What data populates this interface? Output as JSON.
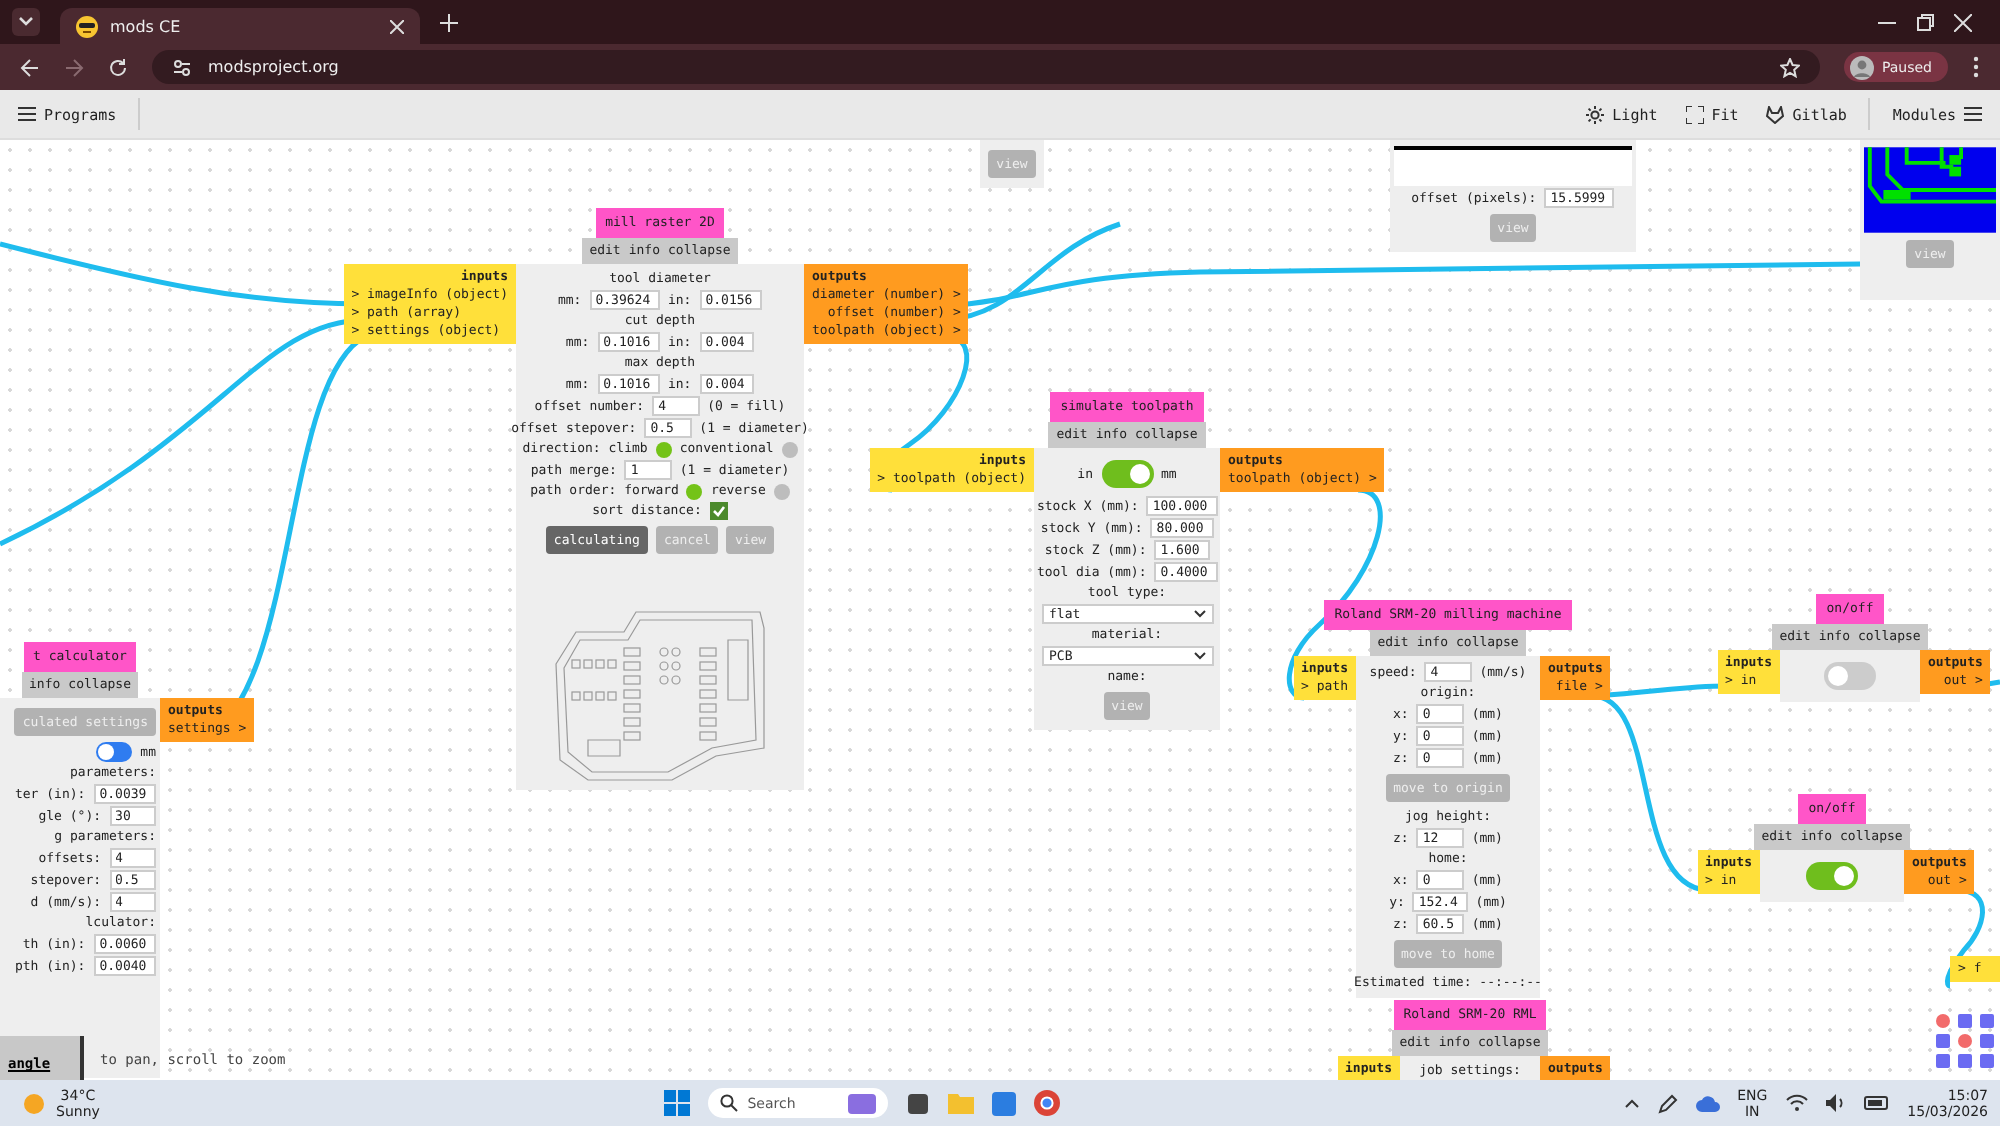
{
  "browser": {
    "tab_title": "mods CE",
    "url": "modsproject.org",
    "profile_label": "Paused"
  },
  "toolbar": {
    "programs": "Programs",
    "light": "Light",
    "fit": "Fit",
    "gitlab": "Gitlab",
    "modules": "Modules"
  },
  "modules": [
    {
      "rows": [
        [
          {
            "kind": "button",
            "label": "view",
            "disabled": true
          }
        ]
      ]
    },
    {
      "title": "mill raster 2D",
      "actions": [
        "edit",
        "info",
        "collapse"
      ],
      "inputs": {
        "label": "inputs",
        "ports": [
          "> imageInfo (object)",
          "> path (array)",
          "> settings (object)"
        ]
      },
      "outputs": {
        "label": "outputs",
        "ports": [
          "diameter (number) >",
          "offset (number) >",
          "toolpath (object) >"
        ]
      },
      "rows": [
        [
          {
            "kind": "text",
            "text": "tool diameter"
          }
        ],
        [
          {
            "kind": "text",
            "text": "mm:"
          },
          {
            "kind": "input",
            "value": "0.39624"
          },
          {
            "kind": "text",
            "text": "in:"
          },
          {
            "kind": "input",
            "value": "0.0156"
          }
        ],
        [
          {
            "kind": "text",
            "text": "cut depth"
          }
        ],
        [
          {
            "kind": "text",
            "text": "mm:"
          },
          {
            "kind": "input",
            "value": "0.1016"
          },
          {
            "kind": "text",
            "text": "in:"
          },
          {
            "kind": "input",
            "value": "0.004"
          }
        ],
        [
          {
            "kind": "text",
            "text": "max depth"
          }
        ],
        [
          {
            "kind": "text",
            "text": "mm:"
          },
          {
            "kind": "input",
            "value": "0.1016"
          },
          {
            "kind": "text",
            "text": "in:"
          },
          {
            "kind": "input",
            "value": "0.004"
          }
        ],
        [
          {
            "kind": "text",
            "text": "offset number:"
          },
          {
            "kind": "input",
            "value": "4"
          },
          {
            "kind": "text",
            "text": "(0 = fill)"
          }
        ],
        [
          {
            "kind": "text",
            "text": "offset stepover:"
          },
          {
            "kind": "input",
            "value": "0.5"
          },
          {
            "kind": "text",
            "text": "(1 = diameter)"
          }
        ],
        [
          {
            "kind": "text",
            "text": "direction: climb"
          },
          {
            "kind": "radio",
            "selected": true
          },
          {
            "kind": "text",
            "text": "conventional"
          },
          {
            "kind": "radio",
            "selected": false
          }
        ],
        [
          {
            "kind": "text",
            "text": "path merge:"
          },
          {
            "kind": "input",
            "value": "1"
          },
          {
            "kind": "text",
            "text": "(1 = diameter)"
          }
        ],
        [
          {
            "kind": "text",
            "text": "path order: forward"
          },
          {
            "kind": "radio",
            "selected": true
          },
          {
            "kind": "text",
            "text": "reverse"
          },
          {
            "kind": "radio",
            "selected": false
          }
        ],
        [
          {
            "kind": "text",
            "text": "sort distance:"
          },
          {
            "kind": "checkbox",
            "checked": true
          }
        ],
        [
          {
            "kind": "button",
            "label": "calculating",
            "disabled": false
          },
          {
            "kind": "button",
            "label": "cancel",
            "disabled": true
          },
          {
            "kind": "button",
            "label": "view",
            "disabled": true
          }
        ],
        [
          {
            "kind": "preview"
          }
        ]
      ]
    },
    {
      "rows": [
        [
          {
            "kind": "strip"
          }
        ],
        [
          {
            "kind": "text",
            "text": "offset (pixels):"
          },
          {
            "kind": "input",
            "value": "15.5999"
          }
        ],
        [
          {
            "kind": "button",
            "label": "view",
            "disabled": true
          }
        ]
      ]
    },
    {
      "rows": [
        [
          {
            "kind": "pcb"
          }
        ],
        [
          {
            "kind": "button",
            "label": "view",
            "disabled": true
          }
        ]
      ]
    },
    {
      "title": "t calculator",
      "actions": [
        "info",
        "collapse"
      ],
      "outputs": {
        "label": "outputs",
        "ports": [
          "settings >"
        ]
      },
      "rows": [
        [
          {
            "kind": "button",
            "label": "culated settings",
            "disabled": true
          }
        ],
        [
          {
            "kind": "switch",
            "on": false
          },
          {
            "kind": "text",
            "text": "mm"
          }
        ],
        [
          {
            "kind": "text",
            "text": "parameters:"
          }
        ],
        [
          {
            "kind": "text",
            "text": "ter (in):"
          },
          {
            "kind": "input",
            "value": "0.0039"
          }
        ],
        [
          {
            "kind": "text",
            "text": "gle (°):"
          },
          {
            "kind": "input",
            "value": "30"
          }
        ],
        [
          {
            "kind": "text",
            "text": "g parameters:"
          }
        ],
        [
          {
            "kind": "text",
            "text": "offsets:"
          },
          {
            "kind": "input",
            "value": "4"
          }
        ],
        [
          {
            "kind": "text",
            "text": "stepover:"
          },
          {
            "kind": "input",
            "value": "0.5"
          }
        ],
        [
          {
            "kind": "text",
            "text": "d (mm/s):"
          },
          {
            "kind": "input",
            "value": "4"
          }
        ],
        [
          {
            "kind": "text",
            "text": "lculator:"
          }
        ],
        [
          {
            "kind": "text",
            "text": "th (in):"
          },
          {
            "kind": "input",
            "value": "0.0060"
          }
        ],
        [
          {
            "kind": "text",
            "text": "pth (in):"
          },
          {
            "kind": "input",
            "value": "0.0040"
          }
        ]
      ]
    },
    {
      "title": "simulate toolpath",
      "actions": [
        "edit",
        "info",
        "collapse"
      ],
      "inputs": {
        "label": "inputs",
        "ports": [
          "> toolpath (object)"
        ]
      },
      "outputs": {
        "label": "outputs",
        "ports": [
          "toolpath (object) >"
        ]
      },
      "rows": [
        [
          {
            "kind": "text",
            "text": "in"
          },
          {
            "kind": "toggle",
            "on": true
          },
          {
            "kind": "text",
            "text": "mm"
          }
        ],
        [
          {
            "kind": "text",
            "text": "stock X (mm):"
          },
          {
            "kind": "input",
            "value": "100.000"
          }
        ],
        [
          {
            "kind": "text",
            "text": "stock Y (mm):"
          },
          {
            "kind": "input",
            "value": "80.000"
          }
        ],
        [
          {
            "kind": "text",
            "text": "stock Z (mm):"
          },
          {
            "kind": "input",
            "value": "1.600"
          }
        ],
        [
          {
            "kind": "text",
            "text": "tool dia (mm):"
          },
          {
            "kind": "input",
            "value": "0.4000"
          }
        ],
        [
          {
            "kind": "text",
            "text": "tool type:"
          }
        ],
        [
          {
            "kind": "select",
            "value": "flat"
          }
        ],
        [
          {
            "kind": "text",
            "text": "material:"
          }
        ],
        [
          {
            "kind": "select",
            "value": "PCB"
          }
        ],
        [
          {
            "kind": "text",
            "text": "name:"
          }
        ],
        [
          {
            "kind": "button",
            "label": "view",
            "disabled": true
          }
        ]
      ]
    },
    {
      "title": "Roland SRM-20 milling machine",
      "actions": [
        "edit",
        "info",
        "collapse"
      ],
      "inputs": {
        "label": "inputs",
        "ports": [
          "> path"
        ]
      },
      "outputs": {
        "label": "outputs",
        "ports": [
          "file >"
        ]
      },
      "rows": [
        [
          {
            "kind": "text",
            "text": "speed:"
          },
          {
            "kind": "input",
            "value": "4"
          },
          {
            "kind": "text",
            "text": "(mm/s)"
          }
        ],
        [
          {
            "kind": "text",
            "text": "origin:"
          }
        ],
        [
          {
            "kind": "text",
            "text": "x:"
          },
          {
            "kind": "input",
            "value": "0"
          },
          {
            "kind": "text",
            "text": "(mm)"
          }
        ],
        [
          {
            "kind": "text",
            "text": "y:"
          },
          {
            "kind": "input",
            "value": "0"
          },
          {
            "kind": "text",
            "text": "(mm)"
          }
        ],
        [
          {
            "kind": "text",
            "text": "z:"
          },
          {
            "kind": "input",
            "value": "0"
          },
          {
            "kind": "text",
            "text": "(mm)"
          }
        ],
        [
          {
            "kind": "button",
            "label": "move to origin",
            "disabled": true
          }
        ],
        [
          {
            "kind": "text",
            "text": "jog height:"
          }
        ],
        [
          {
            "kind": "text",
            "text": "z:"
          },
          {
            "kind": "input",
            "value": "12"
          },
          {
            "kind": "text",
            "text": "(mm)"
          }
        ],
        [
          {
            "kind": "text",
            "text": "home:"
          }
        ],
        [
          {
            "kind": "text",
            "text": "x:"
          },
          {
            "kind": "input",
            "value": "0"
          },
          {
            "kind": "text",
            "text": "(mm)"
          }
        ],
        [
          {
            "kind": "text",
            "text": "y:"
          },
          {
            "kind": "input",
            "value": "152.4"
          },
          {
            "kind": "text",
            "text": "(mm)"
          }
        ],
        [
          {
            "kind": "text",
            "text": "z:"
          },
          {
            "kind": "input",
            "value": "60.5"
          },
          {
            "kind": "text",
            "text": "(mm)"
          }
        ],
        [
          {
            "kind": "button",
            "label": "move to home",
            "disabled": true
          }
        ],
        [
          {
            "kind": "text",
            "text": "Estimated time: --:--:--"
          }
        ]
      ]
    },
    {
      "title": "on/off",
      "actions": [
        "edit",
        "info",
        "collapse"
      ],
      "inputs": {
        "label": "inputs",
        "ports": [
          "> in"
        ]
      },
      "outputs": {
        "label": "outputs",
        "ports": [
          "out >"
        ]
      },
      "rows": [
        [
          {
            "kind": "toggle",
            "on": false
          }
        ]
      ]
    },
    {
      "title": "on/off",
      "actions": [
        "edit",
        "info",
        "collapse"
      ],
      "inputs": {
        "label": "inputs",
        "ports": [
          "> in"
        ]
      },
      "outputs": {
        "label": "outputs",
        "ports": [
          "out >"
        ]
      },
      "rows": [
        [
          {
            "kind": "toggle",
            "on": true
          }
        ]
      ]
    },
    {
      "title": "Roland SRM-20 RML",
      "actions": [
        "edit",
        "info",
        "collapse"
      ],
      "inputs": {
        "label": "inputs"
      },
      "outputs": {
        "label": "outputs"
      },
      "rows": [
        [
          {
            "kind": "text",
            "text": "job settings:"
          }
        ]
      ]
    },
    {
      "inputs": {
        "ports": [
          "> f"
        ]
      }
    }
  ],
  "angle_tab": "angle",
  "canvas_hint": "to pan, scroll to zoom",
  "taskbar": {
    "temperature": "34°C",
    "weather": "Sunny",
    "search_placeholder": "Search",
    "language": "ENG",
    "region": "IN",
    "time": "15:07",
    "date": "15/03/2026"
  }
}
